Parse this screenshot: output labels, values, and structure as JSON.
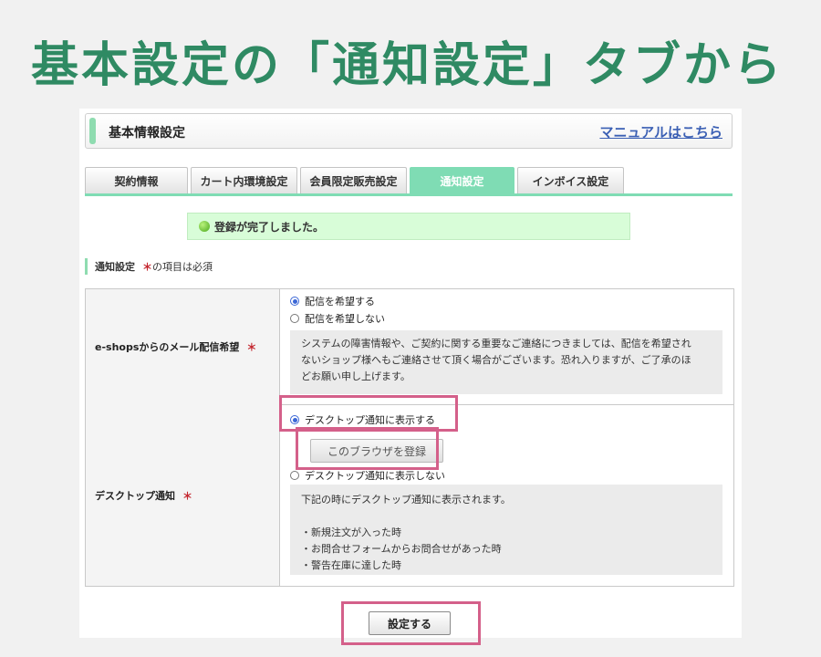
{
  "headline": "基本設定の「通知設定」タブから",
  "header": {
    "title": "基本情報設定",
    "manual_link": "マニュアルはこちら"
  },
  "tabs": [
    {
      "label": "契約情報",
      "active": false
    },
    {
      "label": "カート内環境設定",
      "active": false
    },
    {
      "label": "会員限定販売設定",
      "active": false
    },
    {
      "label": "通知設定",
      "active": true
    },
    {
      "label": "インボイス設定",
      "active": false
    }
  ],
  "notice": {
    "text": "登録が完了しました。"
  },
  "section": {
    "title": "通知設定",
    "required_mark": "＊",
    "required_note": "の項目は必須"
  },
  "mail_setting": {
    "label": "e-shopsからのメール配信希望",
    "required_mark": "＊",
    "options": [
      {
        "label": "配信を希望する",
        "selected": true
      },
      {
        "label": "配信を希望しない",
        "selected": false
      }
    ],
    "info_lines": [
      "システムの障害情報や、ご契約に関する重要なご連絡につきましては、配信を希望され",
      "ないショップ様へもご連絡させて頂く場合がございます。恐れ入りますが、ご了承のほ",
      "どお願い申し上げます。"
    ]
  },
  "desktop_setting": {
    "label": "デスクトップ通知",
    "required_mark": "＊",
    "options": [
      {
        "label": "デスクトップ通知に表示する",
        "selected": true
      },
      {
        "label": "デスクトップ通知に表示しない",
        "selected": false
      }
    ],
    "register_button": "このブラウザを登録",
    "info_intro": "下記の時にデスクトップ通知に表示されます。",
    "info_items": [
      "・新規注文が入った時",
      "・お問合せフォームからお問合せがあった時",
      "・警告在庫に達した時"
    ]
  },
  "submit_button": "設定する",
  "colors": {
    "headline": "#2f8a63",
    "tab_active": "#7fdcb4",
    "notice_bg": "#d8fdd8",
    "highlight": "#d4608a",
    "link": "#3a5fb4",
    "required": "#c4262e"
  }
}
